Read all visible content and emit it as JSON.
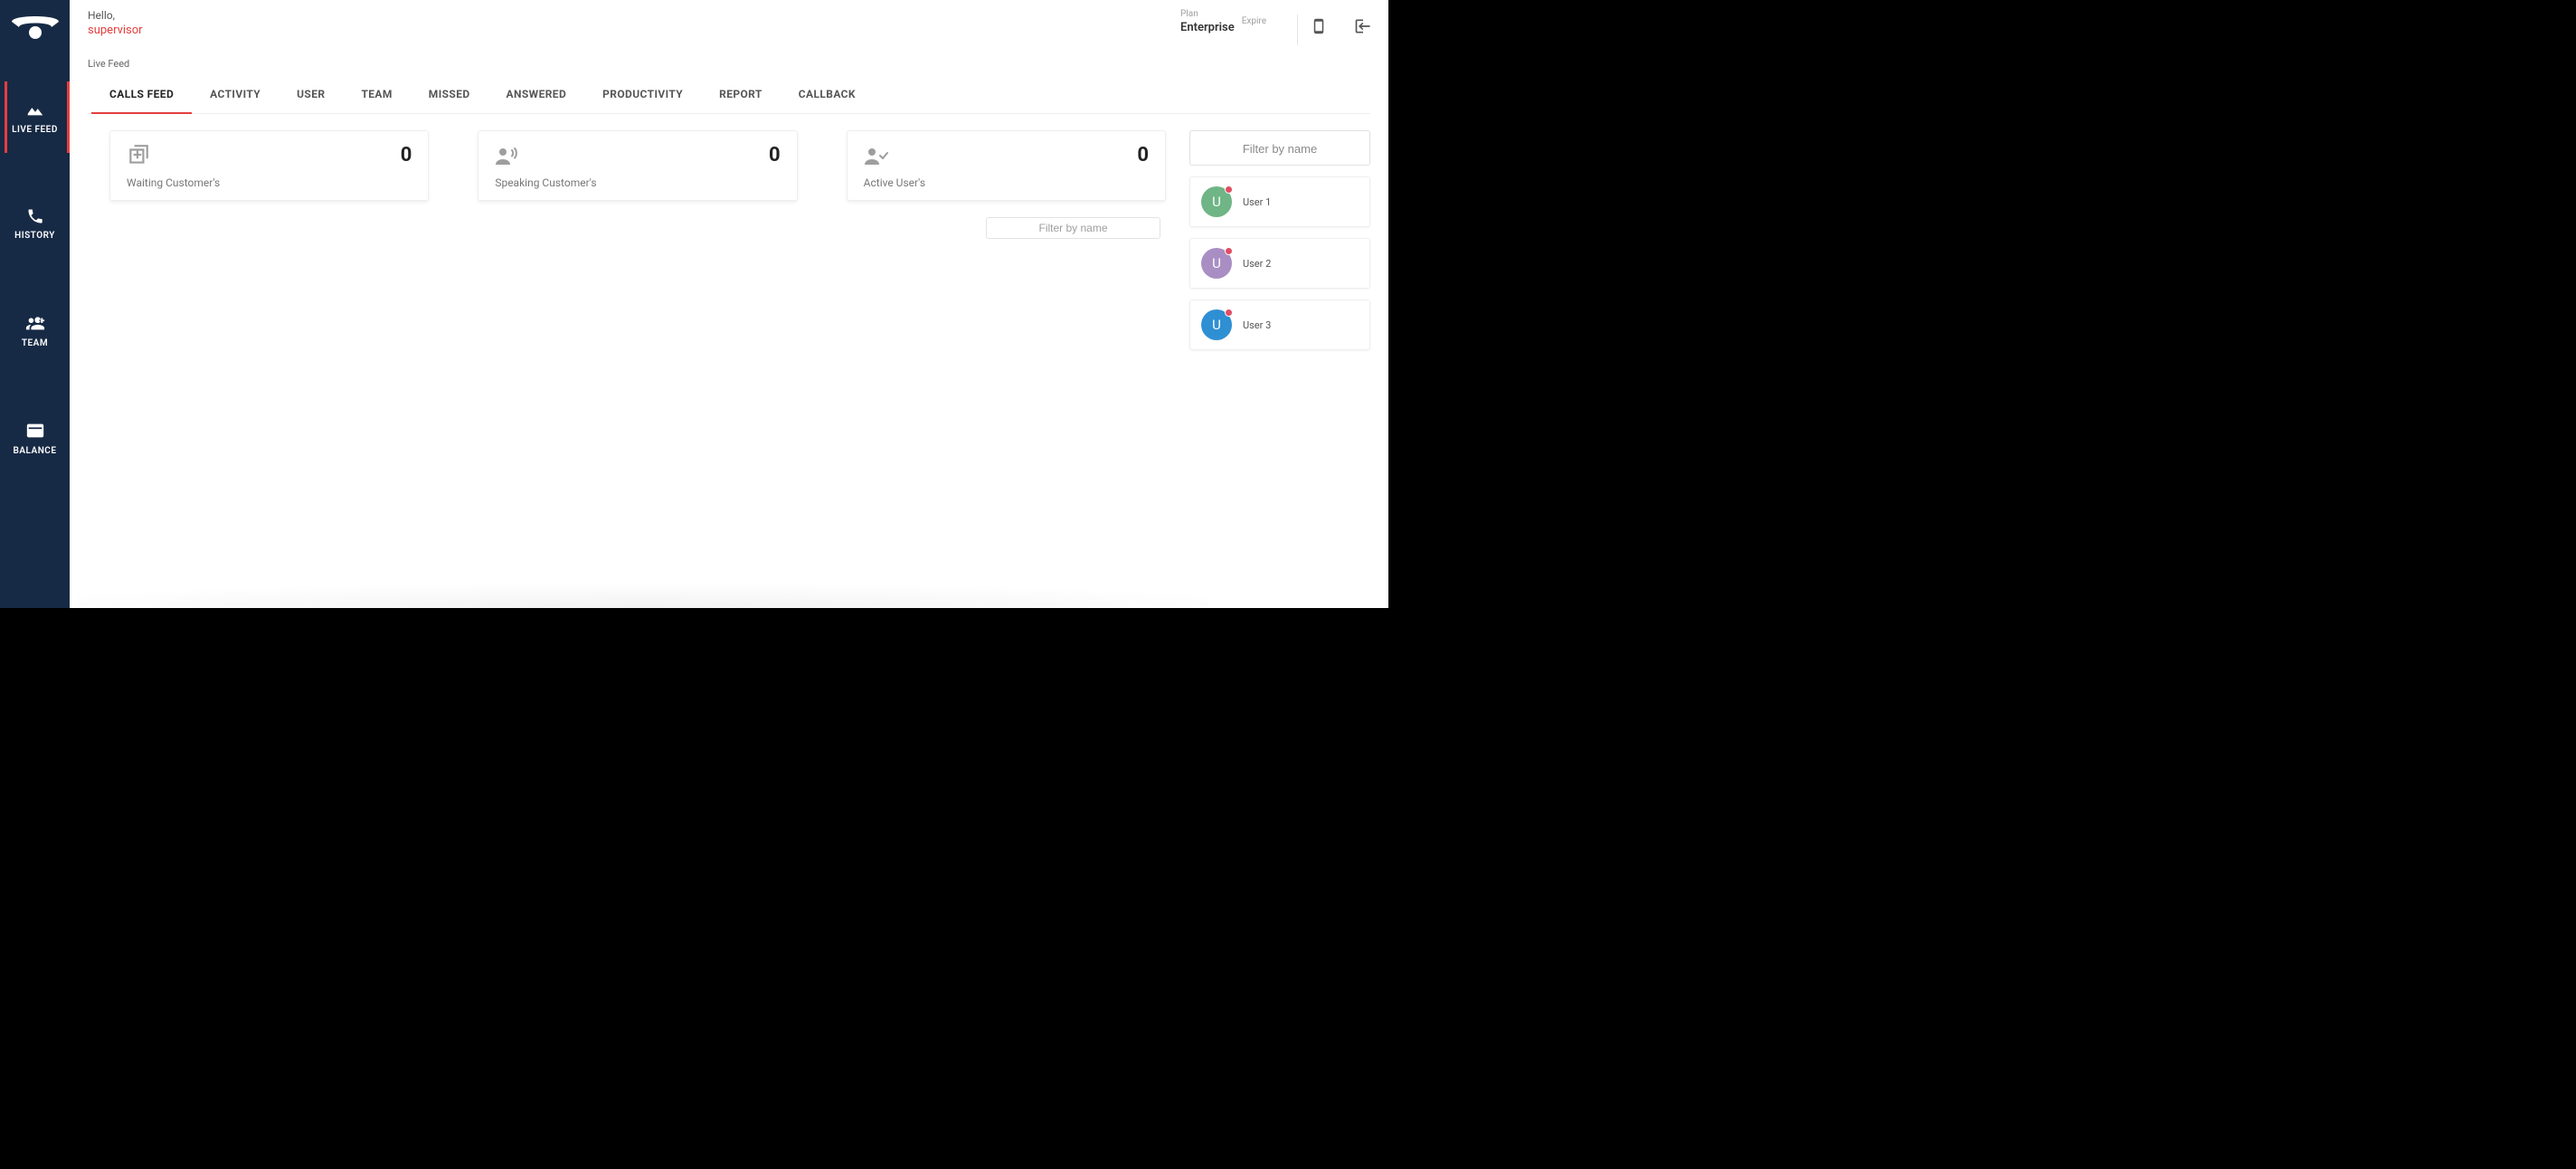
{
  "sidebar": {
    "items": [
      {
        "label": "LIVE FEED"
      },
      {
        "label": "HISTORY"
      },
      {
        "label": "TEAM"
      },
      {
        "label": "BALANCE"
      }
    ]
  },
  "header": {
    "hello": "Hello,",
    "username": "supervisor",
    "plan_label": "Plan",
    "plan_value": "Enterprise",
    "expire_label": "Expire"
  },
  "subheader": {
    "title": "Live Feed"
  },
  "tabs": [
    {
      "label": "CALLS FEED"
    },
    {
      "label": "ACTIVITY"
    },
    {
      "label": "USER"
    },
    {
      "label": "TEAM"
    },
    {
      "label": "MISSED"
    },
    {
      "label": "ANSWERED"
    },
    {
      "label": "PRODUCTIVITY"
    },
    {
      "label": "REPORT"
    },
    {
      "label": "CALLBACK"
    }
  ],
  "stats": [
    {
      "label": "Waiting Customer's",
      "value": "0",
      "icon": "queue-add-icon"
    },
    {
      "label": "Speaking Customer's",
      "value": "0",
      "icon": "speaking-person-icon"
    },
    {
      "label": "Active User's",
      "value": "0",
      "icon": "active-user-icon"
    }
  ],
  "filters": {
    "main_placeholder": "Filter by name",
    "side_placeholder": "Filter by name"
  },
  "users": [
    {
      "name": "User 1",
      "initial": "U",
      "color": "c1",
      "online": false
    },
    {
      "name": "User 2",
      "initial": "U",
      "color": "c2",
      "online": false
    },
    {
      "name": "User 3",
      "initial": "U",
      "color": "c3",
      "online": false
    }
  ]
}
